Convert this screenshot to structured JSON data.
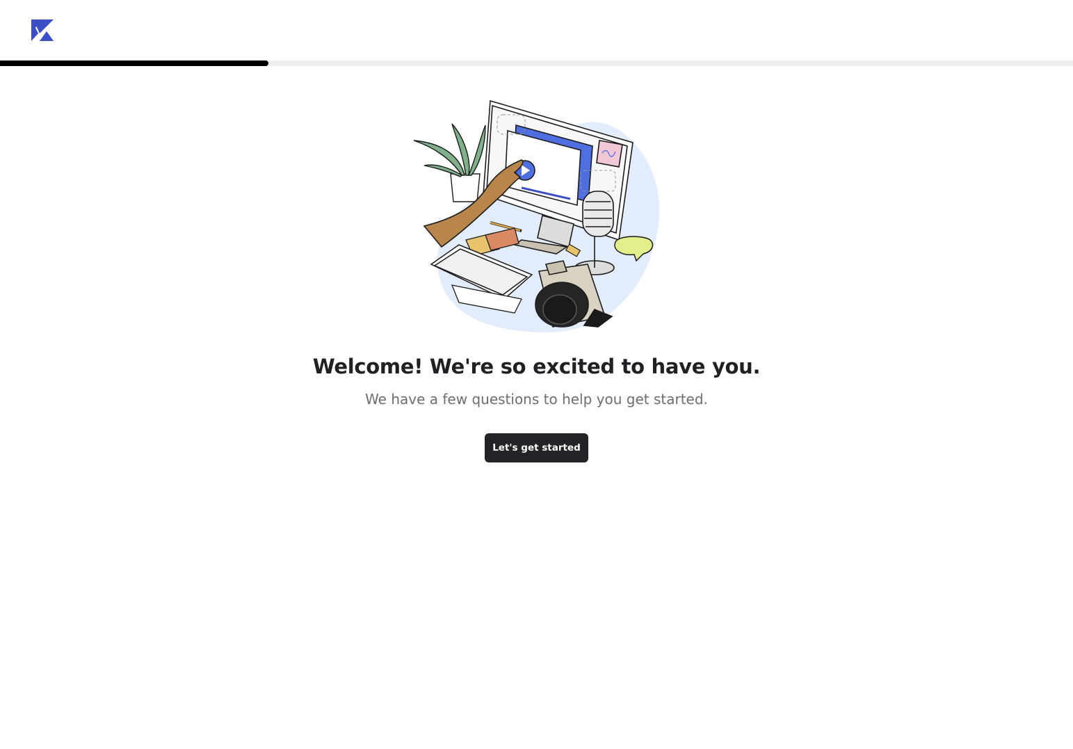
{
  "brand": {
    "logo_icon": "kajabi-k-logo",
    "accent_color": "#3b4fc4"
  },
  "progress": {
    "fraction": 0.25,
    "fill_color": "#000000",
    "track_color": "#efefef"
  },
  "welcome": {
    "illustration_icon": "desk-workspace-illustration",
    "title": "Welcome! We're so excited to have you.",
    "subtitle": "We have a few questions to help you get started.",
    "cta_label": "Let's get started"
  }
}
